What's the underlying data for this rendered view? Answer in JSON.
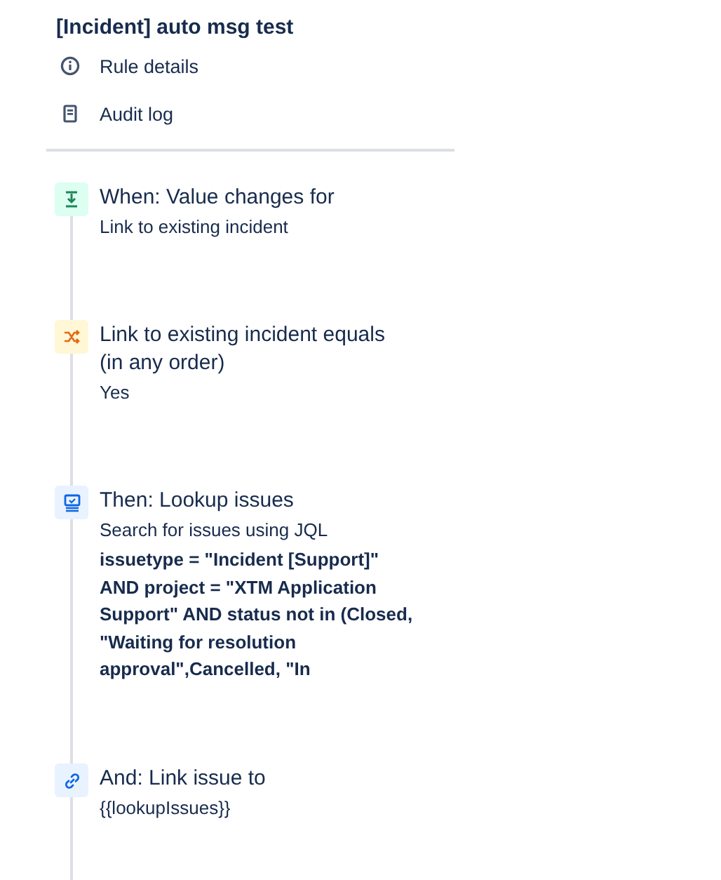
{
  "title": "[Incident] auto msg test",
  "menu": [
    {
      "label": "Rule details",
      "kind": "info"
    },
    {
      "label": "Audit log",
      "kind": "log"
    }
  ],
  "steps": [
    {
      "kind": "trigger",
      "title": "When: Value changes for",
      "details": [
        "Link to existing incident"
      ]
    },
    {
      "kind": "condition",
      "title": "Link to existing incident equals\n(in any order)",
      "details": [
        "Yes"
      ]
    },
    {
      "kind": "lookup",
      "title": "Then: Lookup issues",
      "details": [
        "Search for issues using JQL"
      ],
      "query": "issuetype = \"Incident [Support]\"\nAND project = \"XTM Application\nSupport\" AND status not in (Closed,\n\"Waiting for resolution\napproval\",Cancelled, \"In"
    },
    {
      "kind": "link",
      "title": "And: Link issue to",
      "details": [
        "{{lookupIssues}}"
      ]
    }
  ]
}
